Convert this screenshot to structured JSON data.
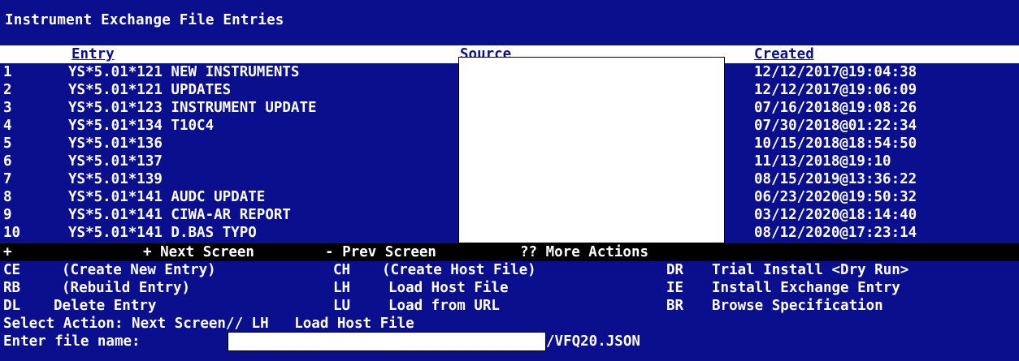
{
  "window": {
    "title": "Instrument Exchange File Entries"
  },
  "columns": {
    "entry": "Entry",
    "source": "Source",
    "created": "Created"
  },
  "rows": [
    {
      "num": "1",
      "entry": "YS*5.01*121 NEW INSTRUMENTS",
      "created": "12/12/2017@19:04:38"
    },
    {
      "num": "2",
      "entry": "YS*5.01*121 UPDATES",
      "created": "12/12/2017@19:06:09"
    },
    {
      "num": "3",
      "entry": "YS*5.01*123 INSTRUMENT UPDATE",
      "created": "07/16/2018@19:08:26"
    },
    {
      "num": "4",
      "entry": "YS*5.01*134 T10C4",
      "created": "07/30/2018@01:22:34"
    },
    {
      "num": "5",
      "entry": "YS*5.01*136",
      "created": "10/15/2018@18:54:50"
    },
    {
      "num": "6",
      "entry": "YS*5.01*137",
      "created": "11/13/2018@19:10"
    },
    {
      "num": "7",
      "entry": "YS*5.01*139",
      "created": "08/15/2019@13:36:22"
    },
    {
      "num": "8",
      "entry": "YS*5.01*141 AUDC UPDATE",
      "created": "06/23/2020@19:50:32"
    },
    {
      "num": "9",
      "entry": "YS*5.01*141 CIWA-AR REPORT",
      "created": "03/12/2020@18:14:40"
    },
    {
      "num": "10",
      "entry": "YS*5.01*141 D.BAS TYPO",
      "created": "08/12/2020@17:23:14"
    }
  ],
  "nav": {
    "plus": "+",
    "next": "+ Next Screen",
    "prev": "- Prev Screen",
    "more": "?? More Actions"
  },
  "actions": [
    {
      "code": "CE",
      "label": "(Create New Entry)"
    },
    {
      "code": "CH",
      "label": "(Create Host File)"
    },
    {
      "code": "DR",
      "label": "Trial Install <Dry Run>"
    },
    {
      "code": "RB",
      "label": "(Rebuild Entry)"
    },
    {
      "code": "LH",
      "label": "Load Host File"
    },
    {
      "code": "IE",
      "label": "Install Exchange Entry"
    },
    {
      "code": "DL",
      "label": "Delete Entry"
    },
    {
      "code": "LU",
      "label": "Load from URL"
    },
    {
      "code": "BR",
      "label": "Browse Specification"
    }
  ],
  "prompt": {
    "select_action": "Select Action: Next Screen// LH   Load Host File",
    "enter_file_label": "Enter file name:",
    "file_value": "/VFQ20.JSON"
  }
}
